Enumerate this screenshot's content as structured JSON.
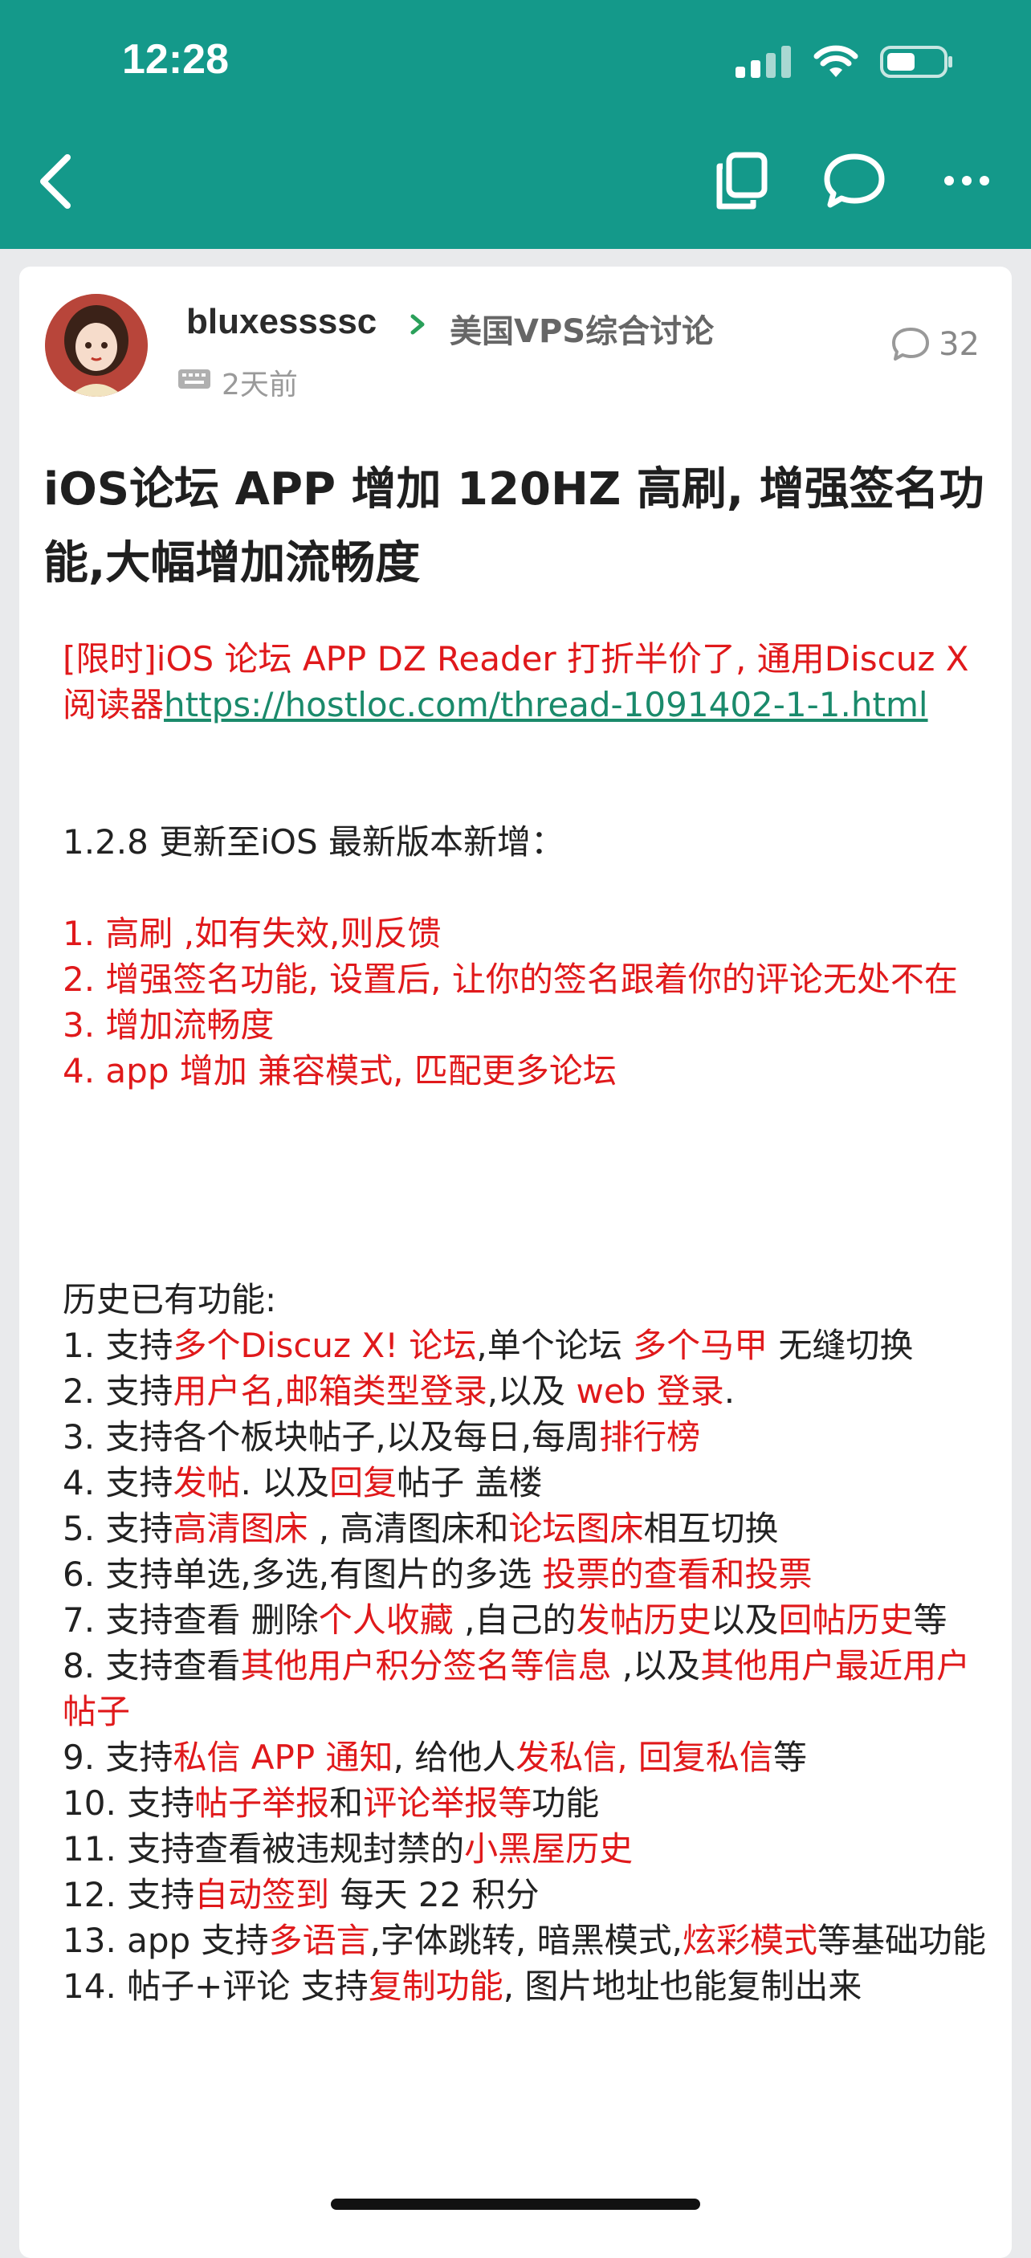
{
  "status": {
    "time": "12:28"
  },
  "header": {
    "back_icon": "chevron-left-icon",
    "actions": [
      "copy-icon",
      "comment-bubble-icon",
      "more-icon"
    ]
  },
  "post": {
    "author": "bluxessssc",
    "forum": "美国VPS综合讨论",
    "time": "2天前",
    "comment_count": "32",
    "title": "iOS论坛 APP 增加 120HZ 高刷, 增强签名功能,大幅增加流畅度",
    "promo_text": "[限时]iOS 论坛 APP DZ Reader 打折半价了, 通用Discuz X 阅读器",
    "promo_link": "https://hostloc.com/thread-1091402-1-1.html",
    "update_header": " 1.2.8 更新至iOS 最新版本新增：",
    "updates": [
      "1. 高刷 ,如有失效,则反馈",
      "2. 增强签名功能, 设置后, 让你的签名跟着你的评论无处不在",
      "3. 增加流畅度",
      "4. app 增加 兼容模式, 匹配更多论坛"
    ],
    "history_header": "历史已有功能:",
    "features": [
      {
        "parts": [
          [
            "1. 支持",
            0
          ],
          [
            "多个Discuz X! 论坛",
            1
          ],
          [
            ",单个论坛 ",
            0
          ],
          [
            "多个马甲",
            1
          ],
          [
            " 无缝切换",
            0
          ]
        ]
      },
      {
        "parts": [
          [
            "2. 支持",
            0
          ],
          [
            "用户名,邮箱类型登录",
            1
          ],
          [
            ",以及 ",
            0
          ],
          [
            "web 登录",
            1
          ],
          [
            ".",
            0
          ]
        ]
      },
      {
        "parts": [
          [
            "3. 支持各个板块帖子,以及每日,每周",
            0
          ],
          [
            "排行榜",
            1
          ]
        ]
      },
      {
        "parts": [
          [
            "4. 支持",
            0
          ],
          [
            "发帖",
            1
          ],
          [
            ". 以及",
            0
          ],
          [
            "回复",
            1
          ],
          [
            "帖子 盖楼",
            0
          ]
        ]
      },
      {
        "parts": [
          [
            "5. 支持",
            0
          ],
          [
            "高清图床",
            1
          ],
          [
            " , 高清图床和",
            0
          ],
          [
            "论坛图床",
            1
          ],
          [
            "相互切换",
            0
          ]
        ]
      },
      {
        "parts": [
          [
            "6. 支持单选,多选,有图片的多选 ",
            0
          ],
          [
            "投票的查看和投票",
            1
          ]
        ]
      },
      {
        "parts": [
          [
            "7. 支持查看 删除",
            0
          ],
          [
            "个人收藏",
            1
          ],
          [
            " ,自己的",
            0
          ],
          [
            "发帖历史",
            1
          ],
          [
            "以及",
            0
          ],
          [
            "回帖历史",
            1
          ],
          [
            "等",
            0
          ]
        ]
      },
      {
        "parts": [
          [
            "8. 支持查看",
            0
          ],
          [
            "其他用户积分签名等信息",
            1
          ],
          [
            " ,以及",
            0
          ],
          [
            "其他用户最近用户帖子",
            1
          ]
        ]
      },
      {
        "parts": [
          [
            "9. 支持",
            0
          ],
          [
            "私信 APP 通知",
            1
          ],
          [
            ", 给他人",
            0
          ],
          [
            "发私信, 回复私信",
            1
          ],
          [
            "等",
            0
          ]
        ]
      },
      {
        "parts": [
          [
            "10. 支持",
            0
          ],
          [
            "帖子举报",
            1
          ],
          [
            "和",
            0
          ],
          [
            "评论举报等",
            1
          ],
          [
            "功能",
            0
          ]
        ]
      },
      {
        "parts": [
          [
            "11. 支持查看被违规封禁的",
            0
          ],
          [
            "小黑屋历史",
            1
          ]
        ]
      },
      {
        "parts": [
          [
            "12. 支持",
            0
          ],
          [
            "自动签到",
            1
          ],
          [
            " 每天 22 积分",
            0
          ]
        ]
      },
      {
        "parts": [
          [
            "13. app 支持",
            0
          ],
          [
            "多语言",
            1
          ],
          [
            ",字体跳转, 暗黑模式,",
            0
          ],
          [
            "炫彩模式",
            1
          ],
          [
            "等基础功能",
            0
          ]
        ]
      },
      {
        "parts": [
          [
            "14. 帖子+评论 支持",
            0
          ],
          [
            "复制功能",
            1
          ],
          [
            ", 图片地址也能复制出来",
            0
          ]
        ]
      }
    ]
  },
  "colors": {
    "header_bg": "#14998a",
    "highlight_red": "#e0191b",
    "link_green": "#1a8a6b"
  }
}
